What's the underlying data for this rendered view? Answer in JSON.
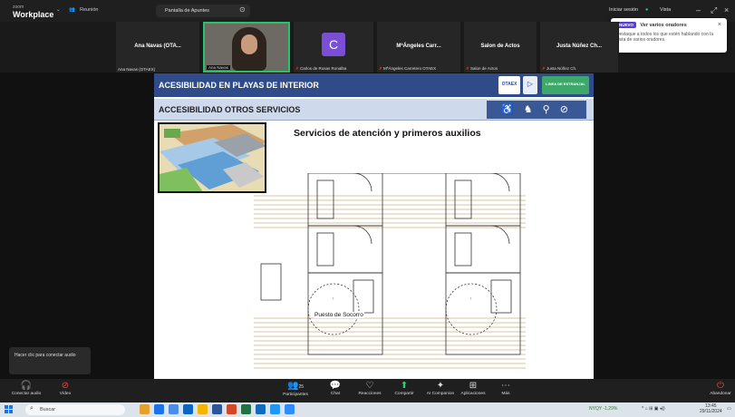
{
  "titlebar": {
    "brand_small": "zoom",
    "brand_big": "Workplace",
    "meeting_label": "Reunión",
    "share_pill": "Pantalla de Apuntes",
    "signin": "Iniciar sesión",
    "view": "Vista"
  },
  "participants": [
    {
      "name": "Ana Navas (OTA...",
      "footer": "Ana Navas (OTAEX)"
    },
    {
      "name": "",
      "footer": "Carlos de Rosas Ronalba"
    },
    {
      "name": "C",
      "footer": "Carlos de Rosas Ronalba"
    },
    {
      "name": "MªÁngeles Carr...",
      "footer": "MªÁngeles Carretero OTAEX"
    },
    {
      "name": "Salon de Actos",
      "footer": "Salon de Actos"
    },
    {
      "name": "Justa Núñez Ch...",
      "footer": "Justa Núñez Ch."
    }
  ],
  "notification": {
    "badge": "NUEVO",
    "title": "Ver varios oradores",
    "body": "Destaque a todos los que estén hablando con la vista de varios oradores.",
    "close": "×"
  },
  "slide": {
    "header": "ACESIBILIDAD EN PLAYAS DE INTERIOR",
    "logo_text": "OTAEX",
    "logo_sub": "LINEA DE ESTRANJAL",
    "subheader": "ACCESIBILIDAD OTROS SERVICIOS",
    "title": "Servicios de atención y primeros auxilios",
    "plan_label": "Puesto de Socorro",
    "access_icons": "♿ ♞ ⚲ ⊘"
  },
  "join_audio": "Hacer clic para conectar audio",
  "toolbar": {
    "items": [
      {
        "label": "Conectar audio",
        "icon": "headphones-icon"
      },
      {
        "label": "Vídeo",
        "icon": "video-off-icon"
      },
      {
        "label": "Participantes",
        "count": "25",
        "icon": "participants-icon"
      },
      {
        "label": "Chat",
        "icon": "chat-icon"
      },
      {
        "label": "Reacciones",
        "icon": "heart-icon"
      },
      {
        "label": "Compartir",
        "icon": "share-icon"
      },
      {
        "label": "AI Companion",
        "icon": "sparkle-icon"
      },
      {
        "label": "Aplicaciones",
        "icon": "apps-icon"
      },
      {
        "label": "Más",
        "icon": "more-icon"
      },
      {
        "label": "Abandonar",
        "icon": "leave-icon"
      }
    ]
  },
  "taskbar": {
    "search": "Buscar",
    "stock": "NYQY -1,29%",
    "time": "13:45",
    "date": "29/11/2024"
  },
  "colors": {
    "slide_header": "#2f4b8a",
    "subheader": "#cfd9ec",
    "zoom_accent": "#26c26c",
    "avatar": "#7b4fd4"
  }
}
